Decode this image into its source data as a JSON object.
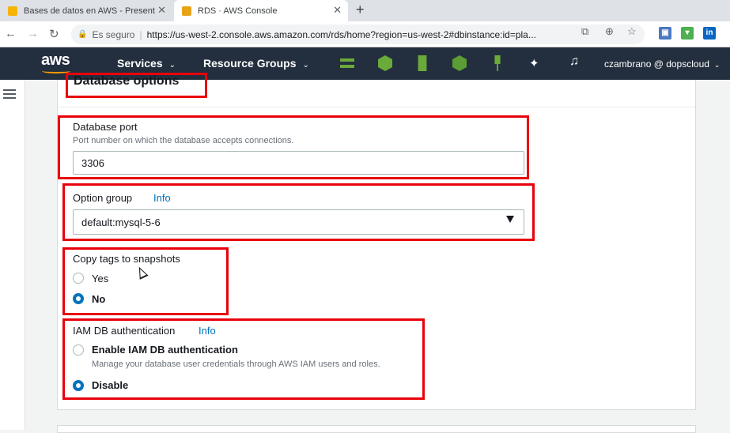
{
  "browser": {
    "tabs": [
      {
        "title": "Bases de datos en AWS - Present",
        "favicon_color": "#f4b400"
      },
      {
        "title": "RDS · AWS Console",
        "favicon_color": "#e8a317"
      }
    ],
    "close_glyph": "✕",
    "new_tab_glyph": "+",
    "omnibox": {
      "secure_label": "Es seguro",
      "url": "https://us-west-2.console.aws.amazon.com/rds/home?region=us-west-2#dbinstance:id=pla..."
    }
  },
  "aws_header": {
    "logo": "aws",
    "services_label": "Services",
    "resource_groups_label": "Resource Groups",
    "user_label": "czambrano @ dopscloud"
  },
  "section": {
    "title": "Database options"
  },
  "db_port": {
    "label": "Database port",
    "description": "Port number on which the database accepts connections.",
    "value": "3306"
  },
  "option_group": {
    "label": "Option group",
    "info_label": "Info",
    "selected": "default:mysql-5-6"
  },
  "copy_tags": {
    "label": "Copy tags to snapshots",
    "options": [
      {
        "label": "Yes",
        "checked": false
      },
      {
        "label": "No",
        "checked": true
      }
    ]
  },
  "iam_auth": {
    "label": "IAM DB authentication",
    "info_label": "Info",
    "enable_label": "Enable IAM DB authentication",
    "enable_description": "Manage your database user credentials through AWS IAM users and roles.",
    "disable_label": "Disable",
    "selected": "Disable"
  },
  "colors": {
    "aws_nav": "#232f3e",
    "accent": "#0073bb",
    "highlight": "#e8000b"
  }
}
